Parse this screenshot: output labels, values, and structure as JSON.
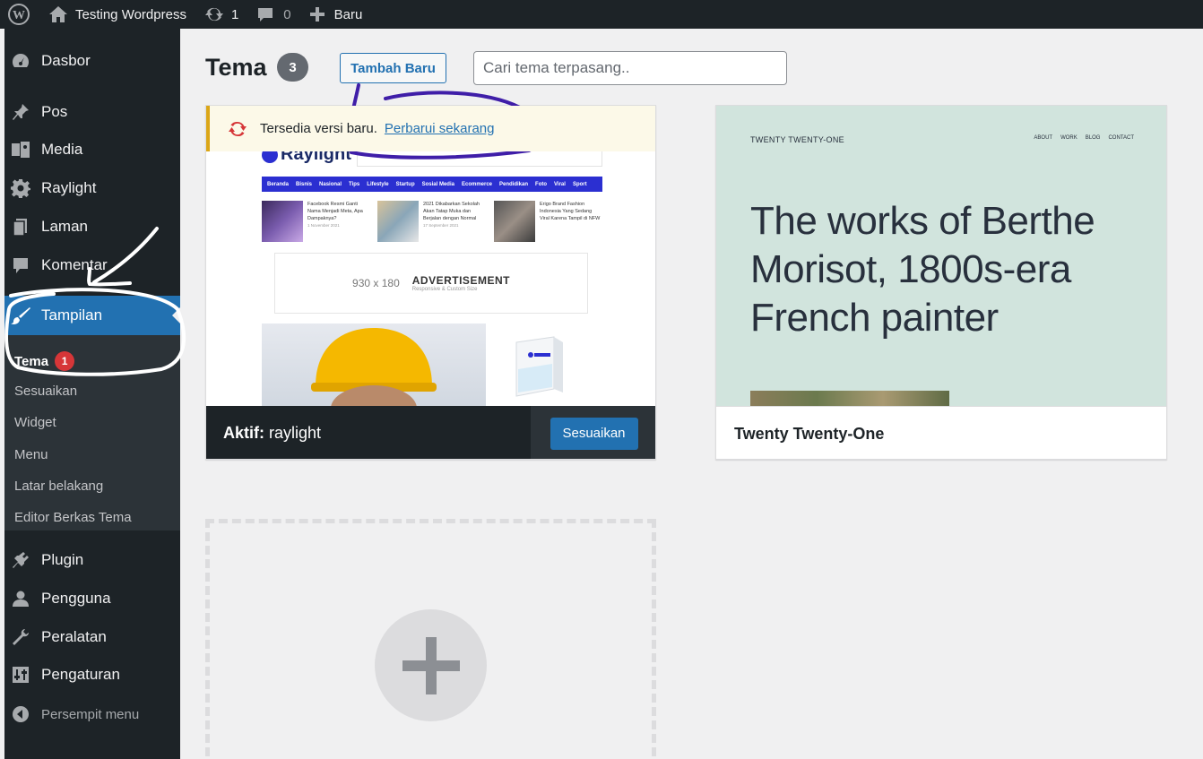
{
  "admin_bar": {
    "site_name": "Testing Wordpress",
    "updates_count": "1",
    "comments_count": "0",
    "new_label": "Baru"
  },
  "sidebar": {
    "items": [
      {
        "label": "Dasbor",
        "icon": "dashboard-icon"
      },
      {
        "label": "Pos",
        "icon": "pin-icon"
      },
      {
        "label": "Media",
        "icon": "media-icon"
      },
      {
        "label": "Raylight",
        "icon": "gear-icon"
      },
      {
        "label": "Laman",
        "icon": "page-icon"
      },
      {
        "label": "Komentar",
        "icon": "comment-icon"
      },
      {
        "label": "Tampilan",
        "icon": "brush-icon"
      },
      {
        "label": "Plugin",
        "icon": "plugin-icon"
      },
      {
        "label": "Pengguna",
        "icon": "user-icon"
      },
      {
        "label": "Peralatan",
        "icon": "wrench-icon"
      },
      {
        "label": "Pengaturan",
        "icon": "settings-icon"
      }
    ],
    "submenu": {
      "current": "Tema",
      "current_badge": "1",
      "items": [
        "Sesuaikan",
        "Widget",
        "Menu",
        "Latar belakang",
        "Editor Berkas Tema"
      ]
    },
    "collapse_label": "Persempit menu"
  },
  "main": {
    "title": "Tema",
    "theme_count": "3",
    "add_new_label": "Tambah Baru",
    "search_placeholder": "Cari tema terpasang.."
  },
  "active_theme": {
    "update_text": "Tersedia versi baru.",
    "update_link": "Perbarui sekarang",
    "active_prefix": "Aktif:",
    "name": "raylight",
    "customize_label": "Sesuaikan",
    "screenshot": {
      "logo": "Raylight",
      "nav": [
        "Beranda",
        "Bisnis",
        "Nasional",
        "Tips",
        "Lifestyle",
        "Startup",
        "Sosial Media",
        "Ecommerce",
        "Pendidikan",
        "Foto",
        "Viral",
        "Sport"
      ],
      "posts": [
        {
          "title": "Facebook Resmi Ganti Nama Menjadi Meta, Apa Dampaknya?",
          "date": "1 November 2021"
        },
        {
          "title": "2021 Dikabarkan Sekolah Akan Tatap Muka dan Berjalan dengan Normal",
          "date": "17 September 2021"
        },
        {
          "title": "Erigo Brand Fashion Indonesia Yang Sedang Viral Karena Tampil di NFW",
          "date": ""
        }
      ],
      "ad_size": "930 x 180",
      "ad_title": "ADVERTISEMENT",
      "ad_sub": "Responsive & Custom Size"
    }
  },
  "theme_tt1": {
    "name": "Twenty Twenty-One",
    "screenshot": {
      "site_title": "TWENTY TWENTY-ONE",
      "nav": [
        "ABOUT",
        "WORK",
        "BLOG",
        "CONTACT"
      ],
      "heading": "The works of Berthe Morisot, 1800s-era French painter"
    }
  },
  "colors": {
    "admin_dark": "#1d2327",
    "accent": "#2271b1",
    "notice_yellow": "#dba617",
    "badge_red": "#d63638",
    "annotation_purple": "#3f1ea8",
    "annotation_white": "#ffffff"
  }
}
